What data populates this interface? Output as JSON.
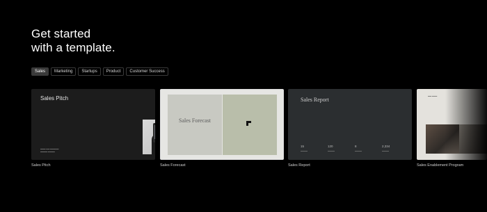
{
  "headline": {
    "line1": "Get started",
    "line2": "with a template."
  },
  "filters": [
    "Sales",
    "Marketing",
    "Startups",
    "Product",
    "Customer Success"
  ],
  "cards": [
    {
      "title": "Sales Pitch",
      "caption": "Sales Pitch"
    },
    {
      "title": "Sales Forecast",
      "caption": "Sales Forecast"
    },
    {
      "title": "Sales Report",
      "caption": "Sales Report",
      "stats": [
        "15",
        "120",
        "8",
        "2,334"
      ]
    },
    {
      "caption": "Sales Enablement Program"
    }
  ],
  "colors": {
    "background": "#000000",
    "chip_active": "#3a3a3a"
  }
}
